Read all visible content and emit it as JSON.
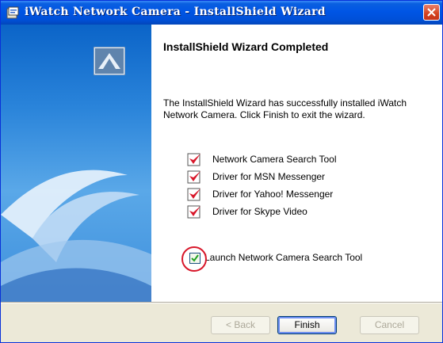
{
  "window": {
    "title": "iWatch Network Camera - InstallShield Wizard"
  },
  "main": {
    "heading": "InstallShield Wizard Completed",
    "description": "The InstallShield Wizard has successfully installed iWatch Network Camera. Click Finish to exit the wizard."
  },
  "features": [
    {
      "label": "Network Camera Search Tool",
      "checked": true
    },
    {
      "label": "Driver for MSN Messenger",
      "checked": true
    },
    {
      "label": "Driver for Yahoo! Messenger",
      "checked": true
    },
    {
      "label": "Driver for Skype Video",
      "checked": true
    }
  ],
  "launch_option": {
    "label": "Launch Network Camera Search Tool",
    "checked": true
  },
  "buttons": {
    "back": "< Back",
    "finish": "Finish",
    "cancel": "Cancel"
  },
  "colors": {
    "titlebar": "#0055e5",
    "highlight_circle": "#d8172a",
    "feature_check": "#d8172a"
  }
}
